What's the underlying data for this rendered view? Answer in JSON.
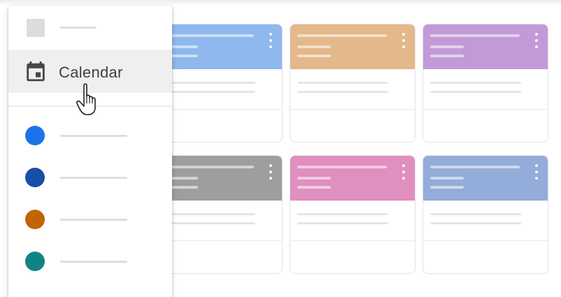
{
  "menu": {
    "home_icon": "square-placeholder-icon",
    "calendar_item": {
      "label": "Calendar",
      "icon": "calendar-icon",
      "highlighted": true
    },
    "classes": [
      {
        "color": "#1a73e8"
      },
      {
        "color": "#174ea6"
      },
      {
        "color": "#c26401"
      },
      {
        "color": "#128383"
      }
    ]
  },
  "cards": [
    {
      "header_color": "#8fb8ee",
      "menu_icon": "more-vert-icon"
    },
    {
      "header_color": "#e3b88b",
      "menu_icon": "more-vert-icon"
    },
    {
      "header_color": "#c39ad8",
      "menu_icon": "more-vert-icon"
    },
    {
      "header_color": "#9e9e9e",
      "menu_icon": "more-vert-icon"
    },
    {
      "header_color": "#e08fbf",
      "menu_icon": "more-vert-icon"
    },
    {
      "header_color": "#93acd9",
      "menu_icon": "more-vert-icon"
    }
  ],
  "cursor": "pointer-hand-icon"
}
